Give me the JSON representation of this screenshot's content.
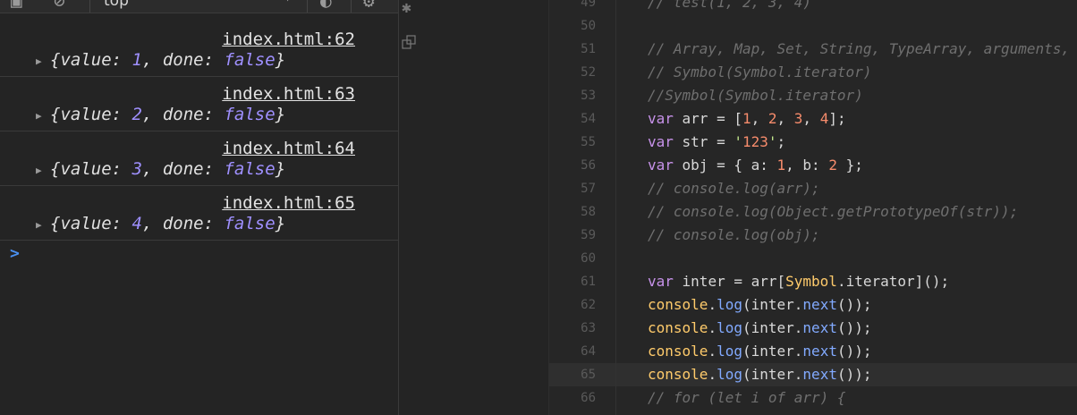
{
  "console": {
    "toolbar": {
      "context": "top",
      "icons": [
        "sidebar-toggle-icon",
        "clear-console-icon",
        "chevron-down-icon",
        "filter-icon",
        "gear-icon"
      ]
    },
    "entries": [
      {
        "source": "index.html:62",
        "value": "1",
        "done": "false"
      },
      {
        "source": "index.html:63",
        "value": "2",
        "done": "false"
      },
      {
        "source": "index.html:64",
        "value": "3",
        "done": "false"
      },
      {
        "source": "index.html:65",
        "value": "4",
        "done": "false"
      }
    ],
    "object_prefix": "{value: ",
    "object_mid": ", done: ",
    "object_suffix": "}",
    "prompt": ">"
  },
  "editor": {
    "lines": [
      {
        "n": "49",
        "text": "// test(1, 2, 3, 4)"
      },
      {
        "n": "50",
        "text": ""
      },
      {
        "n": "51",
        "text": "// Array, Map, Set, String, TypeArray, arguments,"
      },
      {
        "n": "52",
        "text": "// Symbol(Symbol.iterator)"
      },
      {
        "n": "53",
        "text": "//Symbol(Symbol.iterator)"
      },
      {
        "n": "54",
        "text": "var arr = [1, 2, 3, 4];"
      },
      {
        "n": "55",
        "text": "var str = '123';"
      },
      {
        "n": "56",
        "text": "var obj = { a: 1, b: 2 };"
      },
      {
        "n": "57",
        "text": "// console.log(arr);"
      },
      {
        "n": "58",
        "text": "// console.log(Object.getPrototypeOf(str));"
      },
      {
        "n": "59",
        "text": "// console.log(obj);"
      },
      {
        "n": "60",
        "text": ""
      },
      {
        "n": "61",
        "text": "var inter = arr[Symbol.iterator]();"
      },
      {
        "n": "62",
        "text": "console.log(inter.next());"
      },
      {
        "n": "63",
        "text": "console.log(inter.next());"
      },
      {
        "n": "64",
        "text": "console.log(inter.next());"
      },
      {
        "n": "65",
        "text": "console.log(inter.next());"
      },
      {
        "n": "66",
        "text": "// for (let i of arr) {"
      }
    ],
    "active_line": "65"
  }
}
